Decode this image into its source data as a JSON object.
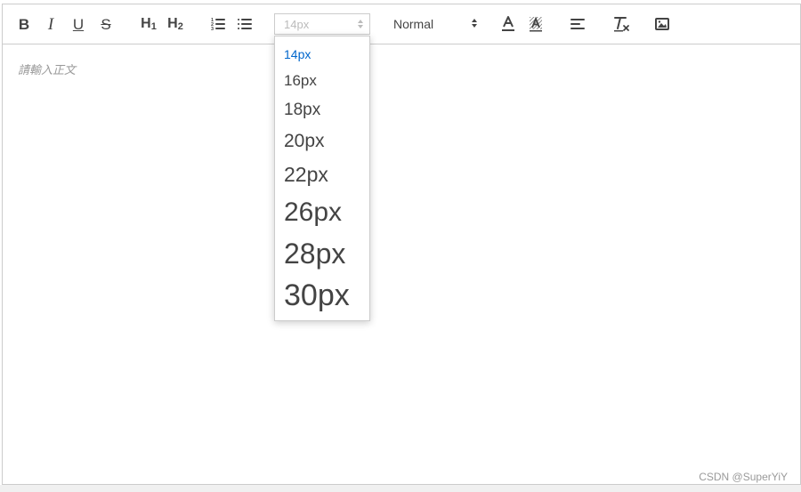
{
  "editor": {
    "placeholder": "請輸入正文"
  },
  "toolbar": {
    "bold_label": "B",
    "italic_label": "I",
    "underline_label": "U",
    "strike_label": "S",
    "h1_label": "H",
    "h1_sub": "1",
    "h2_label": "H",
    "h2_sub": "2",
    "size_current": "14px",
    "header_current": "Normal"
  },
  "size_dropdown": {
    "items": [
      "14px",
      "16px",
      "18px",
      "20px",
      "22px",
      "26px",
      "28px",
      "30px"
    ],
    "selected": "14px"
  },
  "watermark": "CSDN @SuperYiY",
  "colors": {
    "accent": "#0066cc",
    "icon": "#444444",
    "border": "#cccccc",
    "placeholder": "#999999"
  },
  "icons": [
    "ordered-list-icon",
    "bullet-list-icon",
    "font-color-icon",
    "background-color-icon",
    "align-left-icon",
    "clear-format-icon",
    "image-icon"
  ]
}
